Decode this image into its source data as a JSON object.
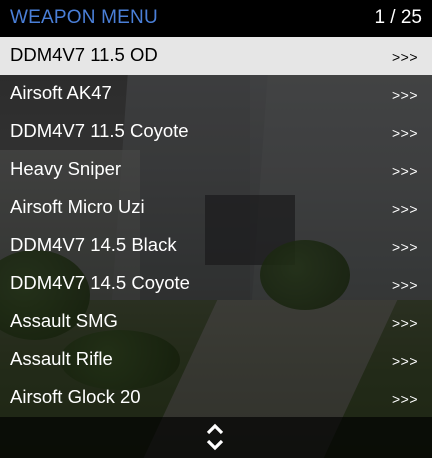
{
  "header": {
    "title": "WEAPON MENU",
    "counter": "1 / 25"
  },
  "items": [
    {
      "label": "DDM4V7 11.5 OD",
      "arrow": ">>>",
      "selected": true
    },
    {
      "label": "Airsoft AK47",
      "arrow": ">>>"
    },
    {
      "label": "DDM4V7 11.5 Coyote",
      "arrow": ">>>"
    },
    {
      "label": "Heavy Sniper",
      "arrow": ">>>"
    },
    {
      "label": "Airsoft Micro Uzi",
      "arrow": ">>>"
    },
    {
      "label": "DDM4V7 14.5 Black",
      "arrow": ">>>"
    },
    {
      "label": "DDM4V7 14.5 Coyote",
      "arrow": ">>>"
    },
    {
      "label": "Assault SMG",
      "arrow": ">>>"
    },
    {
      "label": "Assault Rifle",
      "arrow": ">>>"
    },
    {
      "label": "Airsoft Glock 20",
      "arrow": ">>>"
    }
  ],
  "footer": {
    "icon": "scroll-up-down-icon"
  },
  "colors": {
    "title": "#4a7fd8",
    "selected_bg": "#e6e6e6",
    "header_bg": "#000000"
  }
}
